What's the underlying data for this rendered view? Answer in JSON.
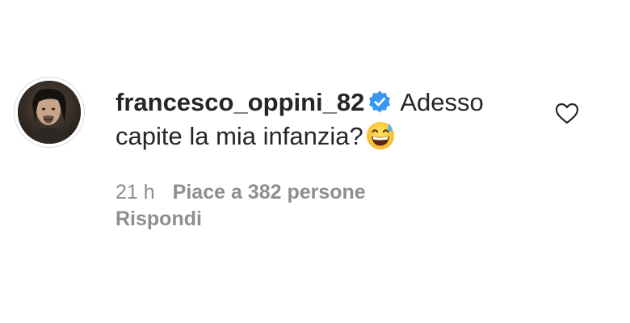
{
  "comment": {
    "username": "francesco_oppini_82",
    "verified": true,
    "text": "Adesso capite la mia infanzia?",
    "emoji": "grinning-face-with-sweat",
    "time": "21 h",
    "likes_text": "Piace a 382 persone",
    "reply_label": "Rispondi"
  },
  "colors": {
    "text": "#262626",
    "muted": "#8e8e8e",
    "verified_badge": "#3897f0",
    "avatar_border": "#dbdbdb"
  },
  "icons": {
    "like": "heart-outline-icon",
    "verified": "verified-badge-icon"
  }
}
